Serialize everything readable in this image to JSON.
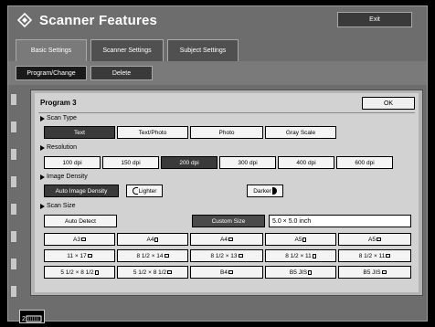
{
  "window": {
    "title": "Scanner Features",
    "exit_label": "Exit"
  },
  "tabs": [
    "Basic Settings",
    "Scanner Settings",
    "Subject Settings"
  ],
  "subtabs": [
    "Program/Change",
    "Delete"
  ],
  "dialog": {
    "title": "Program 3",
    "ok_label": "OK",
    "scan_type": {
      "label": "Scan Type",
      "options": [
        "Text",
        "Text/Photo",
        "Photo",
        "Gray Scale"
      ],
      "selected": "Text"
    },
    "resolution": {
      "label": "Resolution",
      "options": [
        "100 dpi",
        "150 dpi",
        "200 dpi",
        "300 dpi",
        "400 dpi",
        "600 dpi"
      ],
      "selected": "200 dpi"
    },
    "image_density": {
      "label": "Image Density",
      "auto": "Auto Image Density",
      "lighter": "Lighter",
      "darker": "Darker"
    },
    "scan_size": {
      "label": "Scan Size",
      "auto_detect": "Auto Detect",
      "custom_size": "Custom Size",
      "custom_value": "5.0 × 5.0 inch",
      "row1": [
        "A3",
        "A4",
        "A4",
        "A5",
        "A5"
      ],
      "row2": [
        "11 × 17",
        "8 1/2 × 14",
        "8 1/2 × 13",
        "8 1/2 × 11",
        "8 1/2 × 11"
      ],
      "row3": [
        "5 1/2 × 8 1/2",
        "5 1/2 × 8 1/2",
        "B4",
        "B5 JIS",
        "B5 JIS"
      ]
    }
  },
  "status": {
    "indicator": "2"
  }
}
